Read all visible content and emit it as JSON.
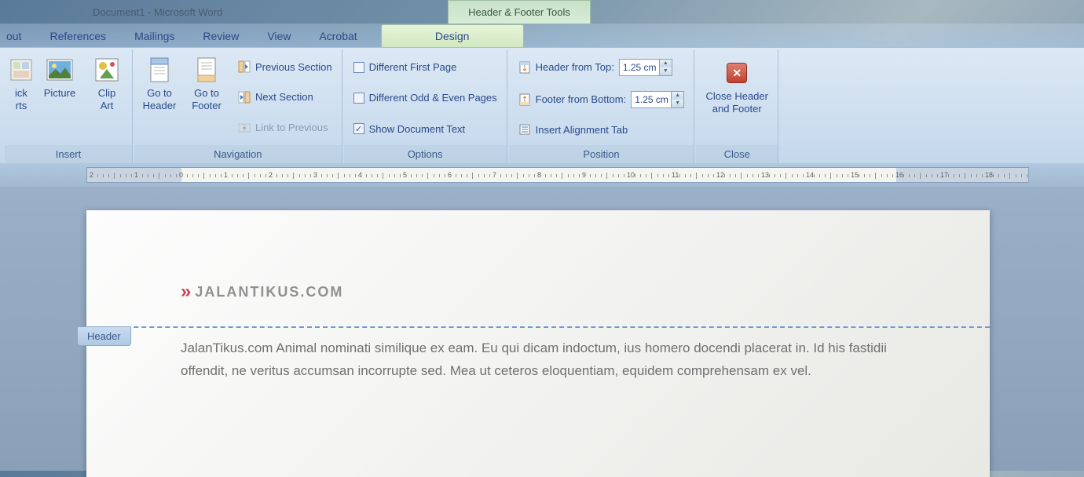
{
  "title": {
    "document": "Document1 - Microsoft Word",
    "contextual": "Header & Footer Tools"
  },
  "tabs": {
    "layout": "out",
    "references": "References",
    "mailings": "Mailings",
    "review": "Review",
    "view": "View",
    "acrobat": "Acrobat",
    "design": "Design"
  },
  "ribbon": {
    "insert": {
      "label": "Insert",
      "quick": "ick\nrts",
      "picture": "Picture",
      "clipart": "Clip\nArt"
    },
    "navigation": {
      "label": "Navigation",
      "goto_header": "Go to\nHeader",
      "goto_footer": "Go to\nFooter",
      "prev_section": "Previous Section",
      "next_section": "Next Section",
      "link_prev": "Link to Previous"
    },
    "options": {
      "label": "Options",
      "diff_first": "Different First Page",
      "diff_oddeven": "Different Odd & Even Pages",
      "show_doc": "Show Document Text"
    },
    "position": {
      "label": "Position",
      "header_top": "Header from Top:",
      "footer_bottom": "Footer from Bottom:",
      "header_val": "1.25 cm",
      "footer_val": "1.25 cm",
      "insert_align": "Insert Alignment Tab"
    },
    "close": {
      "label": "Close",
      "close_btn": "Close Header\nand Footer"
    }
  },
  "document": {
    "header_label": "Header",
    "logo_text": "JALANTIKUS.COM",
    "body": "JalanTikus.com Animal nominati similique ex eam. Eu qui dicam indoctum, ius homero docendi placerat in. Id his fastidii offendit, ne veritus accumsan incorrupte sed. Mea ut ceteros eloquentiam, equidem comprehensam ex vel."
  }
}
